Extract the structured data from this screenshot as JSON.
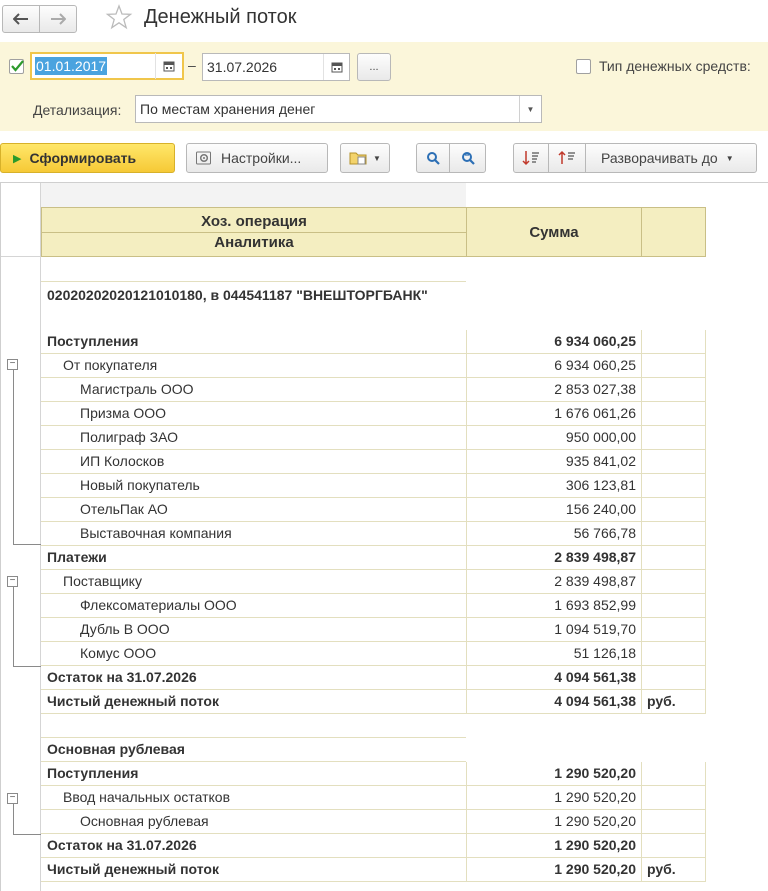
{
  "window": {
    "title": "Денежный поток"
  },
  "filters": {
    "period_enabled": true,
    "date_from": "01.01.2017",
    "date_to": "31.07.2026",
    "dash": "–",
    "more_label": "...",
    "cash_type_label": "Тип денежных средств:",
    "cash_type_checked": false,
    "detail_label": "Детализация:",
    "detail_value": "По местам хранения денег"
  },
  "toolbar": {
    "generate_label": "Сформировать",
    "settings_label": "Настройки...",
    "expand_label": "Разворачивать до"
  },
  "report": {
    "header": {
      "col1_line1": "Хоз. операция",
      "col1_line2": "Аналитика",
      "col2": "Сумма"
    },
    "rows": [
      {
        "type": "sep"
      },
      {
        "type": "section",
        "text": "02020202020121010180, в 044541187 \"ВНЕШТОРГБАНК\""
      },
      {
        "type": "bold",
        "name": "Поступления",
        "amount": "6 934 060,25"
      },
      {
        "type": "l2",
        "name": "От покупателя",
        "amount": "6 934 060,25"
      },
      {
        "type": "l3",
        "name": "Магистраль ООО",
        "amount": "2 853 027,38"
      },
      {
        "type": "l3",
        "name": "Призма ООО",
        "amount": "1 676 061,26"
      },
      {
        "type": "l3",
        "name": "Полиграф ЗАО",
        "amount": "950 000,00"
      },
      {
        "type": "l3",
        "name": "ИП Колосков",
        "amount": "935 841,02"
      },
      {
        "type": "l3",
        "name": "Новый покупатель",
        "amount": "306 123,81"
      },
      {
        "type": "l3",
        "name": "ОтельПак АО",
        "amount": "156 240,00"
      },
      {
        "type": "l3",
        "name": "Выставочная компания",
        "amount": "56 766,78"
      },
      {
        "type": "bold",
        "name": "Платежи",
        "amount": "2 839 498,87"
      },
      {
        "type": "l2",
        "name": "Поставщику",
        "amount": "2 839 498,87"
      },
      {
        "type": "l3",
        "name": "Флексоматериалы ООО",
        "amount": "1 693 852,99"
      },
      {
        "type": "l3",
        "name": "Дубль В ООО",
        "amount": "1 094 519,70"
      },
      {
        "type": "l3",
        "name": "Комус ООО",
        "amount": "51 126,18"
      },
      {
        "type": "bold",
        "name": "Остаток на 31.07.2026",
        "amount": "4 094 561,38"
      },
      {
        "type": "bold",
        "name": "Чистый денежный поток",
        "amount": "4 094 561,38",
        "unit": "руб."
      },
      {
        "type": "sep"
      },
      {
        "type": "boldsec",
        "name": "Основная рублевая"
      },
      {
        "type": "bold",
        "name": "Поступления",
        "amount": "1 290 520,20"
      },
      {
        "type": "l2",
        "name": "Ввод начальных остатков",
        "amount": "1 290 520,20"
      },
      {
        "type": "l3",
        "name": "Основная рублевая",
        "amount": "1 290 520,20"
      },
      {
        "type": "bold",
        "name": "Остаток на 31.07.2026",
        "amount": "1 290 520,20"
      },
      {
        "type": "bold",
        "name": "Чистый денежный поток",
        "amount": "1 290 520,20",
        "unit": "руб."
      }
    ]
  }
}
